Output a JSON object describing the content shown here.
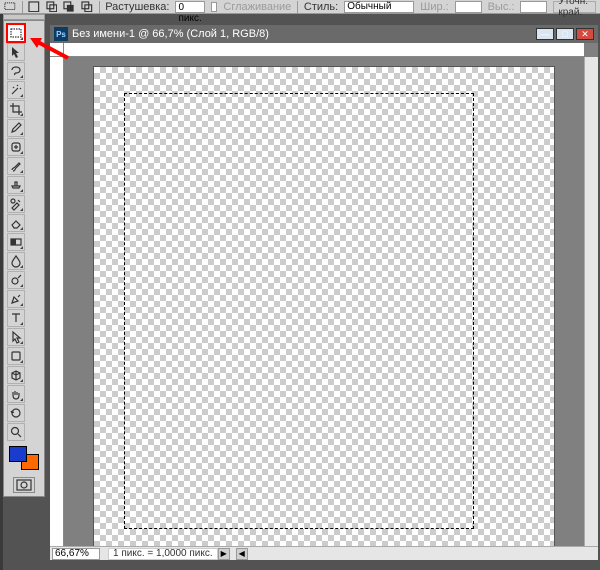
{
  "options_bar": {
    "feather_label": "Растушевка:",
    "feather_value": "0 пикс.",
    "antialias_label": "Сглаживание",
    "style_label": "Стиль:",
    "style_value": "Обычный",
    "width_label": "Шир.:",
    "height_label": "Выс.:",
    "refine_edge_label": "Уточн. край."
  },
  "document": {
    "title": "Без имени-1 @ 66,7% (Слой 1, RGB/8)",
    "ps_badge": "Ps"
  },
  "status": {
    "zoom": "66,67%",
    "info": "1 пикс. = 1,0000 пикс."
  },
  "colors": {
    "foreground": "#1a3ccc",
    "background": "#ff6a00",
    "annotation_arrow": "#ff0000"
  },
  "tools": [
    {
      "name": "marquee-rect",
      "active": true,
      "red": true
    },
    {
      "name": "move"
    },
    {
      "name": "lasso"
    },
    {
      "name": "magic-wand"
    },
    {
      "name": "crop"
    },
    {
      "name": "eyedropper"
    },
    {
      "name": "healing-brush"
    },
    {
      "name": "brush"
    },
    {
      "name": "clone-stamp"
    },
    {
      "name": "history-brush"
    },
    {
      "name": "eraser"
    },
    {
      "name": "gradient"
    },
    {
      "name": "blur"
    },
    {
      "name": "dodge"
    },
    {
      "name": "pen"
    },
    {
      "name": "type"
    },
    {
      "name": "path-select"
    },
    {
      "name": "shapes"
    },
    {
      "name": "3d"
    },
    {
      "name": "hand"
    },
    {
      "name": "rotate-view"
    },
    {
      "name": "zoom"
    }
  ]
}
